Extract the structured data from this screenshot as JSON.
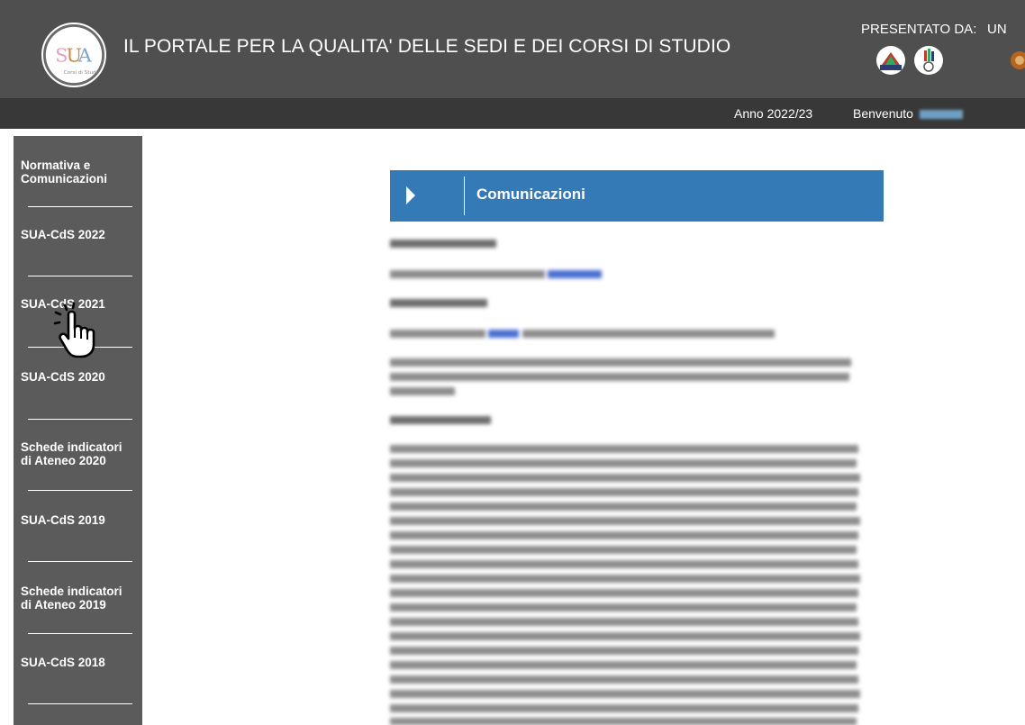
{
  "header": {
    "title": "IL PORTALE PER LA QUALITA' DELLE SEDI E DEI CORSI DI STUDIO",
    "presented_by": "PRESENTATO DA:",
    "partner_label_truncated": "UN",
    "logo_icon": "sua-cds-logo-icon",
    "partner_icons": [
      "anvur-logo-icon",
      "cineca-logo-icon",
      "ministry-emblem-icon"
    ]
  },
  "subheader": {
    "year": "Anno 2022/23",
    "welcome": "Benvenuto"
  },
  "sidebar": {
    "items": [
      {
        "label": "Normativa e Comunicazioni"
      },
      {
        "label": "SUA-CdS 2022"
      },
      {
        "label": "SUA-CdS 2021"
      },
      {
        "label": "SUA-CdS 2020"
      },
      {
        "label": "Schede indicatori di Ateneo 2020"
      },
      {
        "label": "SUA-CdS 2019"
      },
      {
        "label": "Schede indicatori di Ateneo 2019"
      },
      {
        "label": "SUA-CdS 2018"
      }
    ]
  },
  "content": {
    "section_title": "Comunicazioni"
  },
  "colors": {
    "topbar": "#4f4f4f",
    "subbar": "#383838",
    "sidebar": "#5b5b5b",
    "panel": "#337ab7"
  }
}
